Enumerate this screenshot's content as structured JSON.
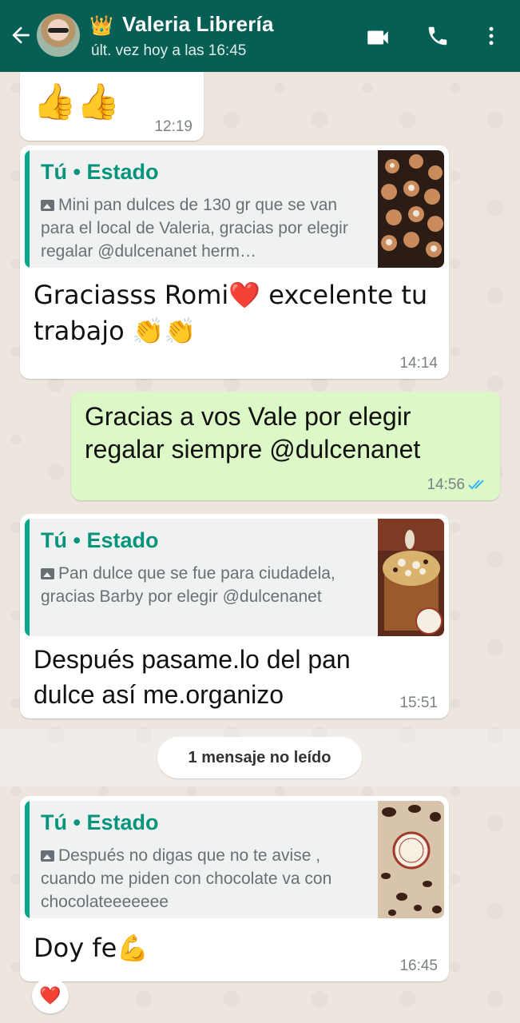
{
  "header": {
    "contact_name": "Valeria Librería",
    "crown_emoji": "👑",
    "last_seen": "últ. vez hoy a las 16:45",
    "icons": [
      "back-arrow-icon",
      "video-call-icon",
      "phone-icon",
      "more-vert-icon"
    ],
    "bg_color": "#075e54"
  },
  "messages": [
    {
      "text": "👍👍",
      "time": "12:19"
    },
    {
      "quote_author": "Tú • Estado",
      "quote_text": "Mini pan dulces de 130 gr que se van para el local de Valeria, gracias por elegir regalar @dulcenanet herm…",
      "text": "Graciasss Romi❤️ excelente tu trabajo 👏👏",
      "time": "14:14"
    },
    {
      "text": "Gracias a vos Vale por elegir regalar siempre @dulcenanet",
      "time": "14:56",
      "status": "read"
    },
    {
      "quote_author": "Tú • Estado",
      "quote_text": "Pan dulce que se fue para ciudadela, gracias Barby por elegir @dulcenanet",
      "text": "Después pasame.lo del pan dulce así me.organizo",
      "time": "15:51"
    },
    {
      "quote_author": "Tú • Estado",
      "quote_text": "Después no digas que no te avise , cuando me piden con chocolate va con chocolateeeeeee",
      "text": "Doy fe💪",
      "time": "16:45",
      "reaction": "❤️"
    }
  ],
  "unread_divider": "1 mensaje no leído",
  "colors": {
    "accent": "#06947d",
    "outgoing_bubble": "#dcf8c6",
    "read_ticks": "#34b7f1"
  }
}
